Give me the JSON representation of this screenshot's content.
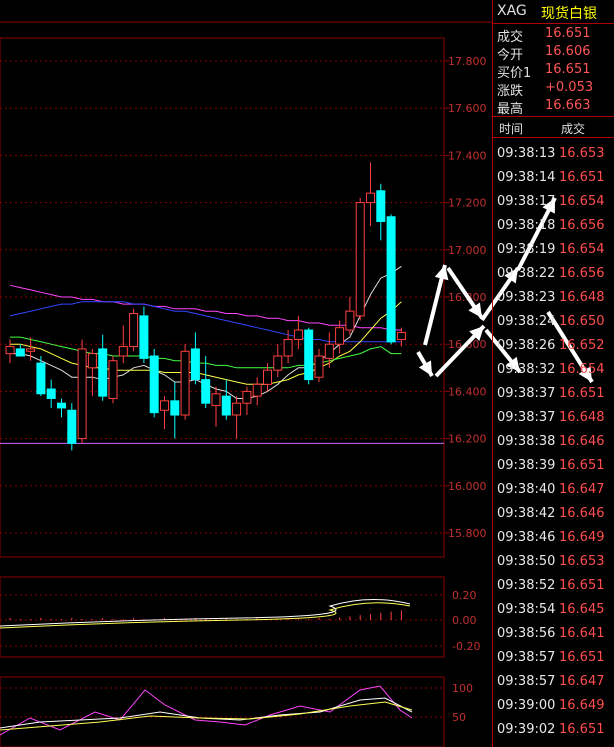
{
  "header": {
    "symbol": "XAG",
    "name": "现货白银"
  },
  "quote": [
    {
      "label": "成交",
      "value": "16.651"
    },
    {
      "label": "今开",
      "value": "16.606"
    },
    {
      "label": "买价1",
      "value": "16.651"
    },
    {
      "label": "涨跌",
      "value": "+0.053"
    },
    {
      "label": "最高",
      "value": "16.663"
    }
  ],
  "ticks_header": {
    "time": "时间",
    "price": "成交"
  },
  "ticks": [
    {
      "time": "09:38:13",
      "price": "16.653"
    },
    {
      "time": "09:38:14",
      "price": "16.651"
    },
    {
      "time": "09:38:17",
      "price": "16.654"
    },
    {
      "time": "09:38:18",
      "price": "16.656"
    },
    {
      "time": "09:38:19",
      "price": "16.654"
    },
    {
      "time": "09:38:22",
      "price": "16.656"
    },
    {
      "time": "09:38:23",
      "price": "16.648"
    },
    {
      "time": "09:38:24",
      "price": "16.650"
    },
    {
      "time": "09:38:26",
      "price": "16.652"
    },
    {
      "time": "09:38:32",
      "price": "16.654"
    },
    {
      "time": "09:38:37",
      "price": "16.651"
    },
    {
      "time": "09:38:37",
      "price": "16.648"
    },
    {
      "time": "09:38:38",
      "price": "16.646"
    },
    {
      "time": "09:38:39",
      "price": "16.651"
    },
    {
      "time": "09:38:40",
      "price": "16.647"
    },
    {
      "time": "09:38:42",
      "price": "16.646"
    },
    {
      "time": "09:38:46",
      "price": "16.649"
    },
    {
      "time": "09:38:50",
      "price": "16.653"
    },
    {
      "time": "09:38:52",
      "price": "16.651"
    },
    {
      "time": "09:38:54",
      "price": "16.645"
    },
    {
      "time": "09:38:56",
      "price": "16.641"
    },
    {
      "time": "09:38:57",
      "price": "16.651"
    },
    {
      "time": "09:38:57",
      "price": "16.647"
    },
    {
      "time": "09:39:00",
      "price": "16.649"
    },
    {
      "time": "09:39:02",
      "price": "16.651"
    }
  ],
  "colors": {
    "up": "#ff4040",
    "down": "#00ffff",
    "grid": "#8b0000"
  },
  "chart_data": [
    {
      "type": "candlestick",
      "y_ticks": [
        "17.800",
        "17.600",
        "17.400",
        "17.200",
        "17.000",
        "16.800",
        "16.600",
        "16.400",
        "16.200",
        "16.000",
        "15.800"
      ],
      "ylim": [
        15.75,
        17.85
      ],
      "candles": [
        {
          "o": 16.56,
          "h": 16.62,
          "l": 16.52,
          "c": 16.59
        },
        {
          "o": 16.58,
          "h": 16.6,
          "l": 16.55,
          "c": 16.55
        },
        {
          "o": 16.57,
          "h": 16.63,
          "l": 16.53,
          "c": 16.58
        },
        {
          "o": 16.52,
          "h": 16.55,
          "l": 16.38,
          "c": 16.39
        },
        {
          "o": 16.41,
          "h": 16.45,
          "l": 16.33,
          "c": 16.37
        },
        {
          "o": 16.35,
          "h": 16.37,
          "l": 16.29,
          "c": 16.33
        },
        {
          "o": 16.32,
          "h": 16.35,
          "l": 16.15,
          "c": 16.18
        },
        {
          "o": 16.2,
          "h": 16.62,
          "l": 16.18,
          "c": 16.58
        },
        {
          "o": 16.5,
          "h": 16.58,
          "l": 16.38,
          "c": 16.56
        },
        {
          "o": 16.58,
          "h": 16.64,
          "l": 16.36,
          "c": 16.38
        },
        {
          "o": 16.37,
          "h": 16.55,
          "l": 16.35,
          "c": 16.53
        },
        {
          "o": 16.55,
          "h": 16.68,
          "l": 16.52,
          "c": 16.59
        },
        {
          "o": 16.59,
          "h": 16.75,
          "l": 16.57,
          "c": 16.73
        },
        {
          "o": 16.72,
          "h": 16.76,
          "l": 16.52,
          "c": 16.54
        },
        {
          "o": 16.55,
          "h": 16.58,
          "l": 16.29,
          "c": 16.31
        },
        {
          "o": 16.32,
          "h": 16.38,
          "l": 16.24,
          "c": 16.36
        },
        {
          "o": 16.36,
          "h": 16.44,
          "l": 16.2,
          "c": 16.3
        },
        {
          "o": 16.3,
          "h": 16.6,
          "l": 16.28,
          "c": 16.57
        },
        {
          "o": 16.58,
          "h": 16.65,
          "l": 16.43,
          "c": 16.45
        },
        {
          "o": 16.45,
          "h": 16.55,
          "l": 16.33,
          "c": 16.35
        },
        {
          "o": 16.34,
          "h": 16.42,
          "l": 16.25,
          "c": 16.39
        },
        {
          "o": 16.38,
          "h": 16.45,
          "l": 16.28,
          "c": 16.3
        },
        {
          "o": 16.3,
          "h": 16.38,
          "l": 16.2,
          "c": 16.35
        },
        {
          "o": 16.35,
          "h": 16.42,
          "l": 16.3,
          "c": 16.4
        },
        {
          "o": 16.38,
          "h": 16.46,
          "l": 16.34,
          "c": 16.43
        },
        {
          "o": 16.43,
          "h": 16.52,
          "l": 16.4,
          "c": 16.49
        },
        {
          "o": 16.49,
          "h": 16.6,
          "l": 16.46,
          "c": 16.55
        },
        {
          "o": 16.55,
          "h": 16.66,
          "l": 16.52,
          "c": 16.62
        },
        {
          "o": 16.62,
          "h": 16.72,
          "l": 16.58,
          "c": 16.66
        },
        {
          "o": 16.66,
          "h": 16.67,
          "l": 16.43,
          "c": 16.45
        },
        {
          "o": 16.46,
          "h": 16.58,
          "l": 16.44,
          "c": 16.55
        },
        {
          "o": 16.54,
          "h": 16.65,
          "l": 16.5,
          "c": 16.6
        },
        {
          "o": 16.6,
          "h": 16.7,
          "l": 16.56,
          "c": 16.67
        },
        {
          "o": 16.66,
          "h": 16.8,
          "l": 16.64,
          "c": 16.74
        },
        {
          "o": 16.72,
          "h": 17.22,
          "l": 16.7,
          "c": 17.2
        },
        {
          "o": 17.2,
          "h": 17.37,
          "l": 17.1,
          "c": 17.24
        },
        {
          "o": 17.25,
          "h": 17.28,
          "l": 17.04,
          "c": 17.12
        },
        {
          "o": 17.14,
          "h": 17.15,
          "l": 16.6,
          "c": 16.61
        },
        {
          "o": 16.62,
          "h": 16.67,
          "l": 16.59,
          "c": 16.65
        }
      ],
      "ma_lines": [
        {
          "color": "#ff44ff",
          "values": [
            16.85,
            16.84,
            16.83,
            16.82,
            16.81,
            16.8,
            16.8,
            16.79,
            16.79,
            16.78,
            16.78,
            16.77,
            16.77,
            16.77,
            16.76,
            16.76,
            16.75,
            16.75,
            16.75,
            16.74,
            16.74,
            16.73,
            16.73,
            16.72,
            16.72,
            16.71,
            16.71,
            16.7,
            16.7,
            16.69,
            16.69,
            16.68,
            16.68,
            16.68,
            16.67,
            16.67,
            16.67,
            16.66,
            16.66
          ]
        },
        {
          "color": "#3344ff",
          "values": [
            16.72,
            16.73,
            16.74,
            16.75,
            16.76,
            16.77,
            16.77,
            16.78,
            16.78,
            16.78,
            16.78,
            16.78,
            16.77,
            16.77,
            16.76,
            16.75,
            16.74,
            16.74,
            16.73,
            16.72,
            16.71,
            16.7,
            16.69,
            16.68,
            16.67,
            16.66,
            16.65,
            16.64,
            16.63,
            16.62,
            16.62,
            16.61,
            16.61,
            16.61,
            16.61,
            16.61,
            16.61,
            16.61,
            16.61
          ]
        },
        {
          "color": "#dddddd",
          "values": [
            16.56,
            16.56,
            16.55,
            16.53,
            16.51,
            16.49,
            16.46,
            16.46,
            16.46,
            16.45,
            16.46,
            16.47,
            16.5,
            16.51,
            16.49,
            16.47,
            16.44,
            16.44,
            16.45,
            16.43,
            16.41,
            16.4,
            16.37,
            16.37,
            16.38,
            16.4,
            16.43,
            16.47,
            16.5,
            16.5,
            16.53,
            16.56,
            16.6,
            16.63,
            16.72,
            16.81,
            16.88,
            16.9,
            16.93
          ]
        },
        {
          "color": "#ffff44",
          "values": [
            16.6,
            16.6,
            16.59,
            16.58,
            16.56,
            16.54,
            16.52,
            16.51,
            16.5,
            16.5,
            16.49,
            16.49,
            16.49,
            16.49,
            16.49,
            16.48,
            16.48,
            16.48,
            16.48,
            16.47,
            16.46,
            16.45,
            16.44,
            16.43,
            16.43,
            16.43,
            16.44,
            16.45,
            16.47,
            16.48,
            16.5,
            16.52,
            16.55,
            16.57,
            16.61,
            16.66,
            16.71,
            16.74,
            16.78
          ]
        },
        {
          "color": "#44ff44",
          "values": [
            16.63,
            16.63,
            16.62,
            16.61,
            16.6,
            16.59,
            16.58,
            16.57,
            16.56,
            16.56,
            16.55,
            16.55,
            16.55,
            16.55,
            16.54,
            16.54,
            16.53,
            16.53,
            16.52,
            16.52,
            16.51,
            16.51,
            16.5,
            16.5,
            16.5,
            16.5,
            16.5,
            16.5,
            16.51,
            16.51,
            16.52,
            16.53,
            16.54,
            16.55,
            16.56,
            16.58,
            16.59,
            16.56,
            16.56
          ]
        }
      ],
      "support_line": 16.18
    },
    {
      "type": "bar",
      "y_ticks": [
        "0.20",
        "0.00",
        "-0.20"
      ],
      "ylim": [
        -0.25,
        0.25
      ]
    },
    {
      "type": "line",
      "y_ticks": [
        "100",
        "50"
      ],
      "ylim": [
        0,
        110
      ]
    }
  ]
}
